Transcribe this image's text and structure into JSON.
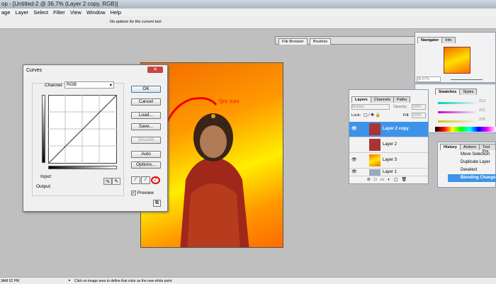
{
  "window": {
    "title": "op - [Untitled-2 @ 36.7% (Layer 2 copy, RGB)]"
  },
  "menu": [
    "age",
    "Layer",
    "Select",
    "Filter",
    "View",
    "Window",
    "Help"
  ],
  "options_bar": {
    "message": "No options for the current tool"
  },
  "palette_well": {
    "tabs": [
      "File Browser",
      "Brushes"
    ]
  },
  "annotation": "ক্লিক করুন",
  "curves": {
    "title": "Curves",
    "channel_label": "Channel:",
    "channel_value": "RGB",
    "input_label": "Input:",
    "output_label": "Output:",
    "buttons": {
      "ok": "OK",
      "cancel": "Cancel",
      "load": "Load...",
      "save": "Save...",
      "smooth": "Smooth",
      "auto": "Auto",
      "options": "Options..."
    },
    "preview_label": "Preview",
    "preview_checked": true
  },
  "navigator": {
    "tabs": [
      "Navigator",
      "Info"
    ],
    "zoom": "36.67%"
  },
  "swatches": {
    "tabs": [
      "Swatches",
      "Styles"
    ],
    "values": [
      "212",
      "221",
      "226"
    ]
  },
  "layers": {
    "tabs": [
      "Layers",
      "Channels",
      "Paths"
    ],
    "blend_mode": "Multiply",
    "opacity_label": "Opacity:",
    "opacity": "100%",
    "lock_label": "Lock:",
    "fill_label": "Fill:",
    "fill": "100%",
    "items": [
      {
        "name": "Layer 2 copy",
        "selected": true,
        "visible": true
      },
      {
        "name": "Layer 2",
        "selected": false,
        "visible": false
      },
      {
        "name": "Layer 3",
        "selected": false,
        "visible": true
      },
      {
        "name": "Layer 1",
        "selected": false,
        "visible": true
      }
    ]
  },
  "history": {
    "tabs": [
      "History",
      "Actions",
      "Tool Pre"
    ],
    "items": [
      "Move Selection",
      "Duplicate Layer",
      "Deselect",
      "Blending Change"
    ]
  },
  "status": {
    "time": "3AM 02 PM",
    "message": "Click on image area to define that color as the new white point"
  }
}
